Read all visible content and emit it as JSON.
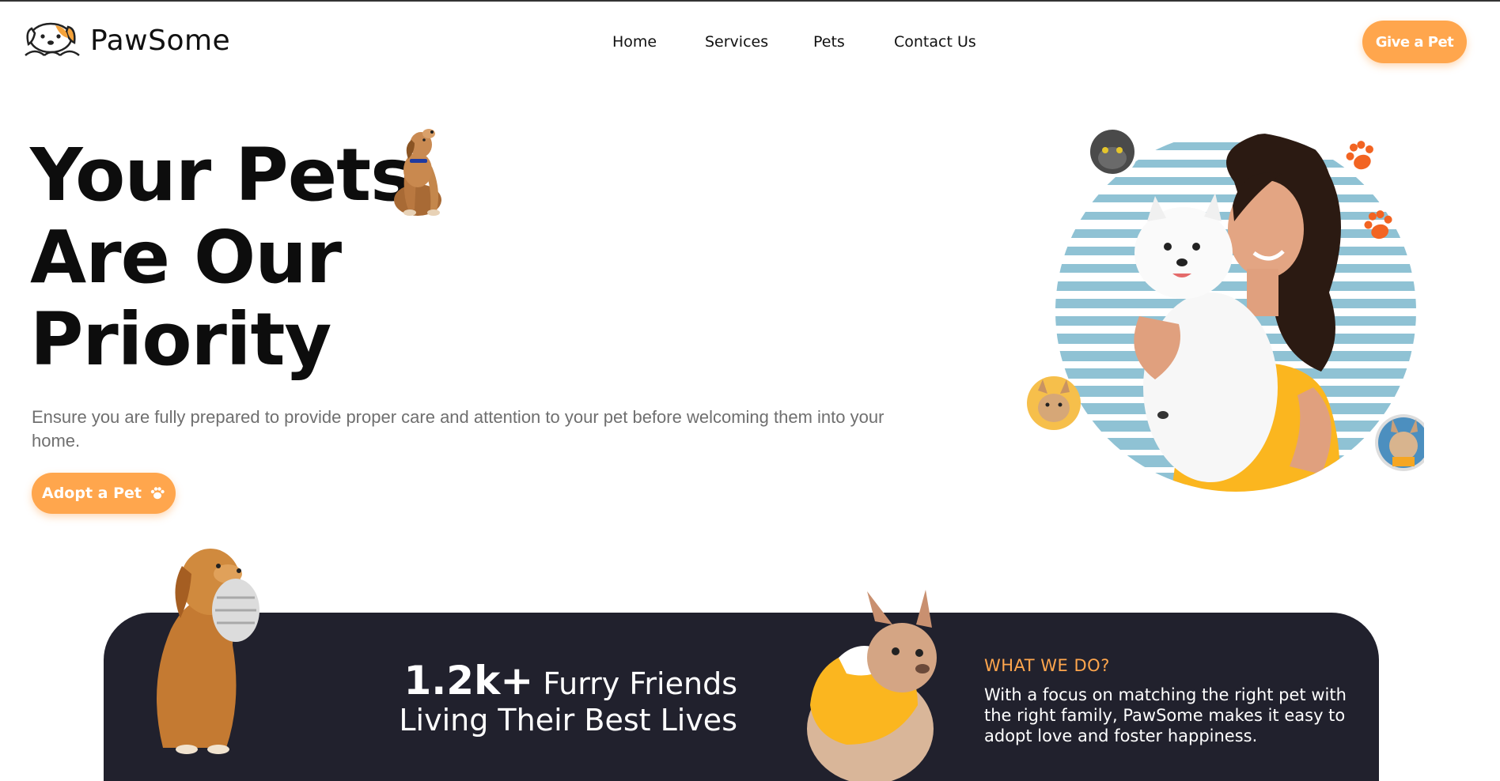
{
  "brand": {
    "name": "PawSome",
    "accent": "#ffa64d",
    "dark": "#21212d"
  },
  "nav": {
    "items": [
      "Home",
      "Services",
      "Pets",
      "Contact Us"
    ],
    "cta": "Give a Pet"
  },
  "hero": {
    "title_lines": [
      "Your Pets",
      "Are Our",
      "Priority"
    ],
    "subtitle": "Ensure you are fully prepared to provide proper care and attention to your pet before welcoming them into your home.",
    "button": "Adopt a Pet",
    "button_icon": "paw-icon"
  },
  "banner": {
    "stat_number": "1.2k+",
    "stat_line1": "Furry Friends",
    "stat_line2": "Living Their Best Lives",
    "section_title": "WHAT WE DO?",
    "section_text": "With a focus on matching the right pet with the right family, PawSome makes it easy to adopt love and foster happiness."
  }
}
